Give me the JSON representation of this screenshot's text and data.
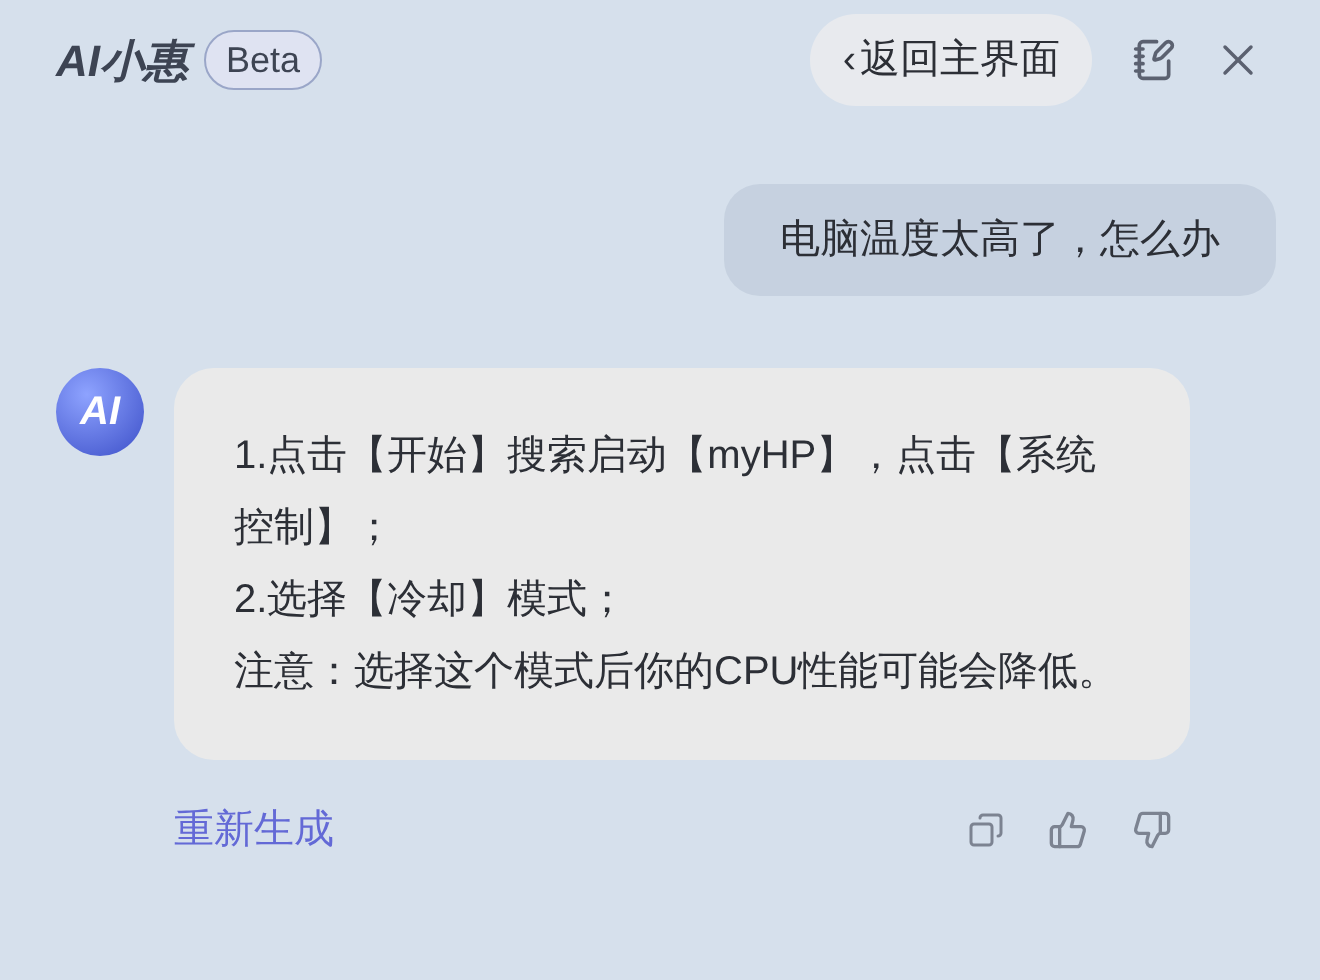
{
  "header": {
    "logo": "AI小惠",
    "badge": "Beta",
    "back_button": "返回主界面",
    "back_chevron": "‹"
  },
  "messages": [
    {
      "kind": "user",
      "text": "电脑温度太高了，怎么办"
    },
    {
      "kind": "assistant",
      "avatar": "AI",
      "paragraphs": [
        "1.点击【开始】搜索启动【myHP】，点击【系统控制】；",
        "2.选择【冷却】模式；",
        "注意：选择这个模式后你的CPU性能可能会降低。"
      ]
    }
  ],
  "regenerate": "重新生成"
}
